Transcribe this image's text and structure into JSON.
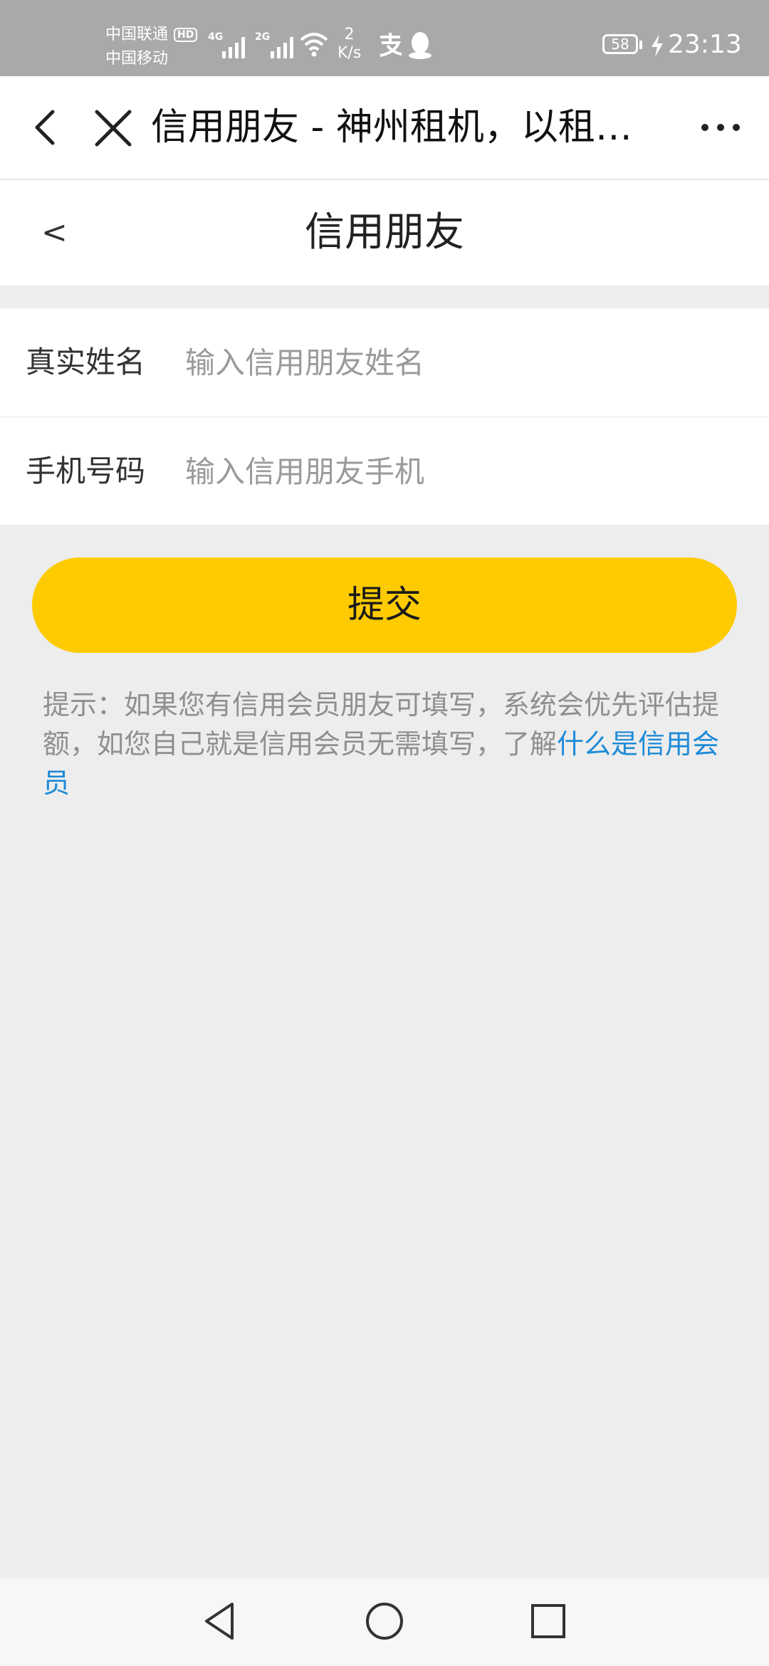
{
  "status_bar": {
    "carrier_1": "中国联通",
    "carrier_2": "中国移动",
    "hd_badge": "HD",
    "network_1": "4G",
    "network_2": "2G",
    "speed_value": "2",
    "speed_unit": "K/s",
    "battery": "58",
    "time": "23:13"
  },
  "titlebar": {
    "title": "信用朋友 - 神州租机，以租…"
  },
  "page": {
    "back_label": "<",
    "title": "信用朋友"
  },
  "form": {
    "name_label": "真实姓名",
    "name_placeholder": "输入信用朋友姓名",
    "name_value": "",
    "phone_label": "手机号码",
    "phone_placeholder": "输入信用朋友手机",
    "phone_value": ""
  },
  "submit_label": "提交",
  "tip": {
    "text": "提示：如果您有信用会员朋友可填写，系统会优先评估提额，如您自己就是信用会员无需填写，了解",
    "link": "什么是信用会员"
  },
  "colors": {
    "accent": "#fecb00",
    "link": "#1c8ad8"
  }
}
